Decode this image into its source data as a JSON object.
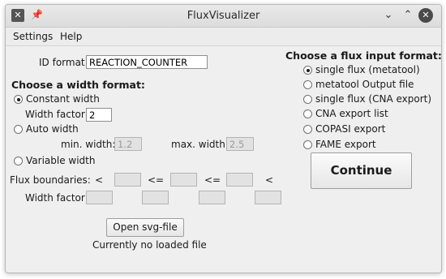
{
  "window": {
    "title": "FluxVisualizer"
  },
  "menu": {
    "settings": "Settings",
    "help": "Help"
  },
  "id_format": {
    "label": "ID format:",
    "value": "REACTION_COUNTER"
  },
  "width_format": {
    "heading": "Choose a width format:",
    "constant": "Constant width",
    "width_factor_label": "Width factor:",
    "width_factor_value": "2",
    "auto": "Auto width",
    "min_label": "min. width:",
    "min_value": "1.2",
    "max_label": "max. width:",
    "max_value": "2.5",
    "variable": "Variable width",
    "selected": "constant"
  },
  "flux_boundaries": {
    "label": "Flux boundaries:",
    "lt": "<",
    "lte": "<=",
    "width_factor_label": "Width factor:"
  },
  "svg": {
    "open_button": "Open svg-file",
    "status": "Currently no loaded file"
  },
  "flux_input": {
    "heading": "Choose a flux input format:",
    "options": [
      "single flux (metatool)",
      "metatool Output file",
      "single flux (CNA export)",
      "CNA export list",
      "COPASI export",
      "FAME export"
    ],
    "selected_index": 0
  },
  "continue_button": "Continue"
}
